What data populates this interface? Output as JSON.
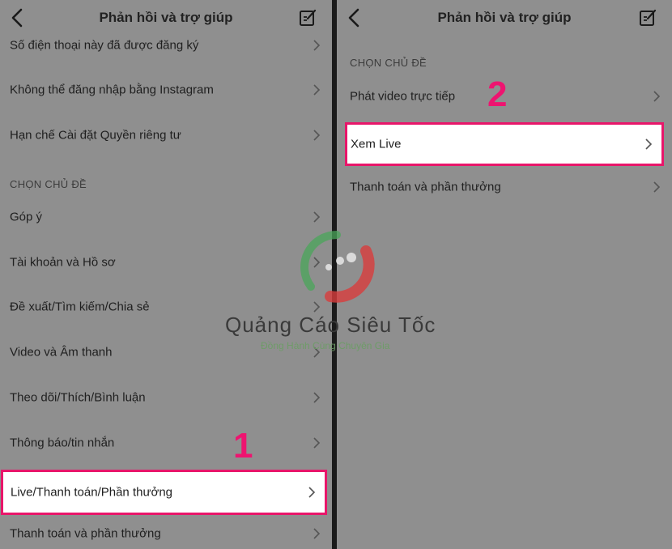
{
  "left": {
    "title": "Phản hồi và trợ giúp",
    "top_items": [
      "Số điện thoại này đã được đăng ký",
      "Không thể đăng nhập bằng Instagram",
      "Hạn chế Cài đặt Quyền riêng tư"
    ],
    "section_label": "CHỌN CHỦ ĐỀ",
    "topic_items": [
      "Góp ý",
      "Tài khoản và Hồ sơ",
      "Đề xuất/Tìm kiếm/Chia sẻ",
      "Video và Âm thanh",
      "Theo dõi/Thích/Bình luận",
      "Thông báo/tin nhắn",
      "Live/Thanh toán/Phần thưởng",
      "Thanh toán và phần thưởng"
    ],
    "step_label": "1"
  },
  "right": {
    "title": "Phản hồi và trợ giúp",
    "section_label": "CHỌN CHỦ ĐỀ",
    "topic_items": [
      "Phát video trực tiếp",
      "Xem Live",
      "Thanh toán và phần thưởng"
    ],
    "step_label": "2"
  },
  "watermark": {
    "brand": "Quảng Cáo Siêu Tốc",
    "tagline": "Đồng Hành Cùng Chuyên Gia"
  },
  "colors": {
    "highlight_border": "#e8166a",
    "step_number": "#ee1470",
    "background": "#8f8f8f"
  },
  "icons": {
    "back": "chevron-left-icon",
    "edit": "edit-note-icon",
    "row": "chevron-right-icon"
  }
}
